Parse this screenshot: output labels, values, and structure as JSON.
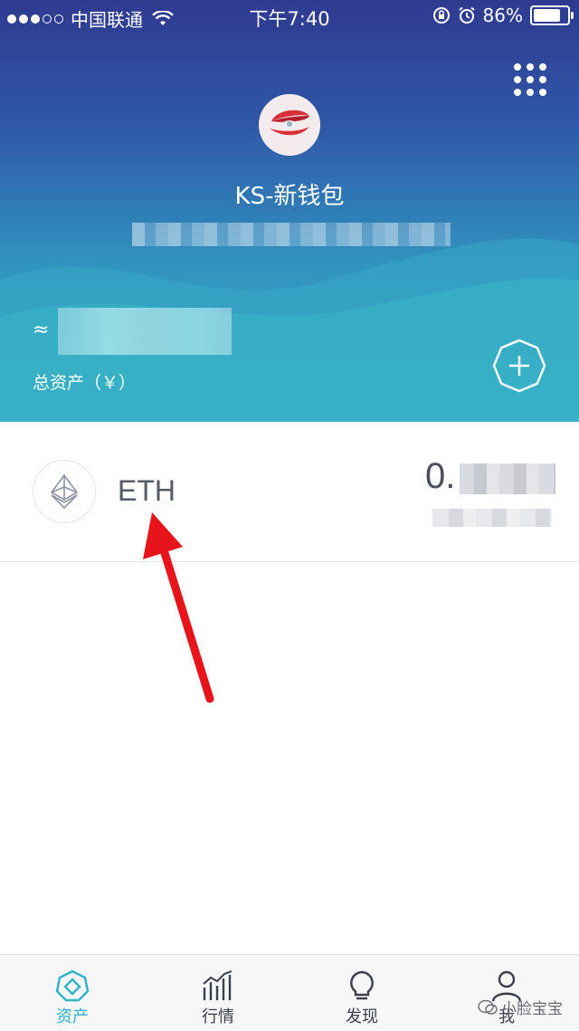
{
  "status_bar": {
    "carrier": "中国联通",
    "time": "下午7:40",
    "battery": "86%",
    "battery_level": 0.86
  },
  "wallet": {
    "name": "KS-新钱包",
    "approx_symbol": "≈",
    "total_label": "总资产（￥）"
  },
  "assets": [
    {
      "symbol": "ETH",
      "amount_visible": "0."
    }
  ],
  "tabs": [
    {
      "label": "资产",
      "icon": "diamond-icon",
      "active": true
    },
    {
      "label": "行情",
      "icon": "chart-bars-icon",
      "active": false
    },
    {
      "label": "发现",
      "icon": "lightbulb-icon",
      "active": false
    },
    {
      "label": "我",
      "icon": "person-icon",
      "active": false
    }
  ],
  "watermark": "小脸宝宝",
  "colors": {
    "header_top": "#2f3a8f",
    "header_bottom": "#38b3c6",
    "accent": "#2fb3c6",
    "arrow": "#e8141b"
  }
}
